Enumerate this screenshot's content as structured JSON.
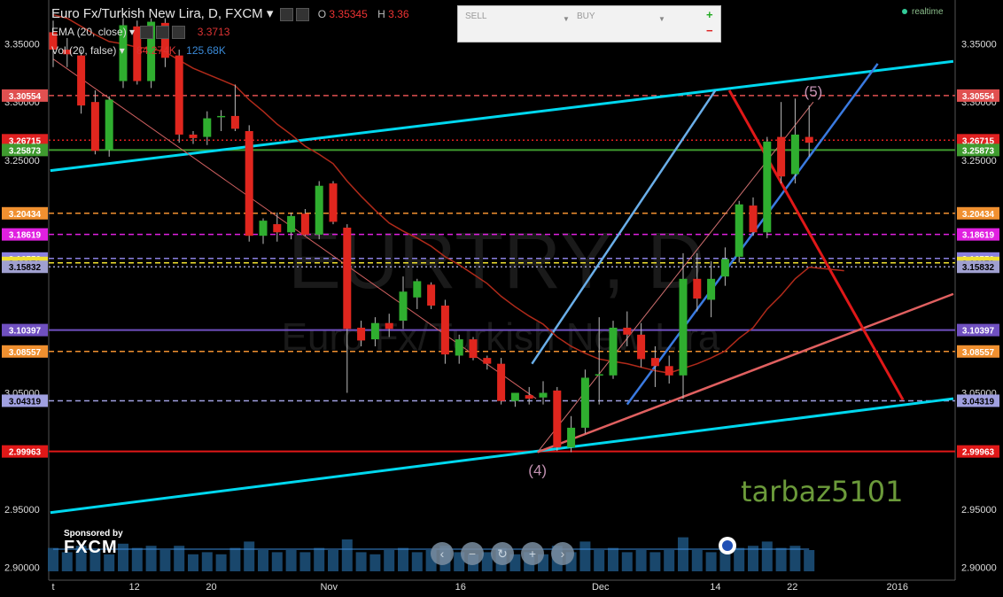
{
  "header": {
    "symbol": "Euro Fx/Turkish New Lira, D, FXCM ▾",
    "open_label": "O",
    "open_value": "3.35345",
    "high_label": "H",
    "high_value": "3.36"
  },
  "indicators": {
    "ema": "EMA (20, close) ▾",
    "ema_value": "3.3713",
    "vol": "Vol (20, false) ▾",
    "vol_value1": "84.274K",
    "vol_value2": "125.68K"
  },
  "trade_panel": {
    "sell_label": "SELL",
    "buy_label": "BUY",
    "plus": "+",
    "minus": "−"
  },
  "status": {
    "realtime": "realtime"
  },
  "sponsor": {
    "text": "Sponsored by",
    "brand": "FXCM"
  },
  "watermark": {
    "big": "EURTRY, D",
    "small": "Euro Fx/Turkish New Lira"
  },
  "author": "tarbaz5101",
  "wave_labels": [
    "(4)",
    "(5)"
  ],
  "nav_buttons": [
    "‹",
    "−",
    "↻",
    "+",
    "›"
  ],
  "colors": {
    "background": "#000000",
    "up": "#2fae2f",
    "down": "#e0261e",
    "ema": "#b02a1a",
    "channel": "#00d8ef"
  },
  "chart_data": {
    "type": "candlestick",
    "title": "Euro Fx/Turkish New Lira, D, FXCM",
    "ylim": [
      2.88,
      3.38
    ],
    "y_ticks": [
      "3.35000",
      "3.30000",
      "3.25000",
      "3.05000",
      "2.95000",
      "2.90000"
    ],
    "x_ticks": [
      "t",
      "12",
      "20",
      "Nov",
      "16",
      "Dec",
      "14",
      "22",
      "2016"
    ],
    "price_levels": [
      {
        "value": "3.30554",
        "color": "#e05050",
        "style": "dash"
      },
      {
        "value": "3.26715",
        "color": "#e02020",
        "style": "dot"
      },
      {
        "value": "3.25873",
        "color": "#3f9b2f",
        "style": "solid"
      },
      {
        "value": "3.20434",
        "color": "#f09030",
        "style": "dash"
      },
      {
        "value": "3.18619",
        "color": "#e020e0",
        "style": "dash"
      },
      {
        "value": "3.16550",
        "color": "#8a80e0",
        "style": "dash"
      },
      {
        "value": "3.16170",
        "color": "#f0e030",
        "style": "dash"
      },
      {
        "value": "3.15832",
        "color": "#a0a0d0",
        "style": "dot"
      },
      {
        "value": "3.10397",
        "color": "#7050c0",
        "style": "solid"
      },
      {
        "value": "3.08557",
        "color": "#f09030",
        "style": "dash"
      },
      {
        "value": "3.04319",
        "color": "#a0a0e0",
        "style": "dash"
      },
      {
        "value": "2.99963",
        "color": "#e01818",
        "style": "solid"
      }
    ],
    "candles": [
      {
        "o": 3.36,
        "h": 3.37,
        "l": 3.33,
        "c": 3.345
      },
      {
        "o": 3.345,
        "h": 3.355,
        "l": 3.33,
        "c": 3.341
      },
      {
        "o": 3.34,
        "h": 3.345,
        "l": 3.29,
        "c": 3.297
      },
      {
        "o": 3.3,
        "h": 3.31,
        "l": 3.255,
        "c": 3.258
      },
      {
        "o": 3.259,
        "h": 3.305,
        "l": 3.253,
        "c": 3.302
      },
      {
        "o": 3.318,
        "h": 3.372,
        "l": 3.312,
        "c": 3.366
      },
      {
        "o": 3.365,
        "h": 3.37,
        "l": 3.315,
        "c": 3.318
      },
      {
        "o": 3.318,
        "h": 3.372,
        "l": 3.312,
        "c": 3.369
      },
      {
        "o": 3.368,
        "h": 3.372,
        "l": 3.33,
        "c": 3.338
      },
      {
        "o": 3.34,
        "h": 3.345,
        "l": 3.265,
        "c": 3.272
      },
      {
        "o": 3.272,
        "h": 3.275,
        "l": 3.264,
        "c": 3.269
      },
      {
        "o": 3.27,
        "h": 3.292,
        "l": 3.263,
        "c": 3.286
      },
      {
        "o": 3.287,
        "h": 3.293,
        "l": 3.275,
        "c": 3.288
      },
      {
        "o": 3.288,
        "h": 3.315,
        "l": 3.275,
        "c": 3.277
      },
      {
        "o": 3.275,
        "h": 3.28,
        "l": 3.18,
        "c": 3.185
      },
      {
        "o": 3.185,
        "h": 3.2,
        "l": 3.178,
        "c": 3.198
      },
      {
        "o": 3.195,
        "h": 3.205,
        "l": 3.18,
        "c": 3.188
      },
      {
        "o": 3.188,
        "h": 3.205,
        "l": 3.182,
        "c": 3.202
      },
      {
        "o": 3.204,
        "h": 3.208,
        "l": 3.185,
        "c": 3.186
      },
      {
        "o": 3.186,
        "h": 3.232,
        "l": 3.182,
        "c": 3.228
      },
      {
        "o": 3.23,
        "h": 3.232,
        "l": 3.195,
        "c": 3.197
      },
      {
        "o": 3.192,
        "h": 3.195,
        "l": 3.05,
        "c": 3.105
      },
      {
        "o": 3.106,
        "h": 3.112,
        "l": 3.09,
        "c": 3.095
      },
      {
        "o": 3.096,
        "h": 3.115,
        "l": 3.09,
        "c": 3.11
      },
      {
        "o": 3.11,
        "h": 3.118,
        "l": 3.098,
        "c": 3.105
      },
      {
        "o": 3.112,
        "h": 3.15,
        "l": 3.105,
        "c": 3.137
      },
      {
        "o": 3.132,
        "h": 3.148,
        "l": 3.122,
        "c": 3.146
      },
      {
        "o": 3.143,
        "h": 3.145,
        "l": 3.122,
        "c": 3.125
      },
      {
        "o": 3.125,
        "h": 3.13,
        "l": 3.075,
        "c": 3.083
      },
      {
        "o": 3.082,
        "h": 3.1,
        "l": 3.075,
        "c": 3.096
      },
      {
        "o": 3.096,
        "h": 3.098,
        "l": 3.078,
        "c": 3.08
      },
      {
        "o": 3.08,
        "h": 3.082,
        "l": 3.07,
        "c": 3.075
      },
      {
        "o": 3.075,
        "h": 3.08,
        "l": 3.04,
        "c": 3.043
      },
      {
        "o": 3.043,
        "h": 3.05,
        "l": 3.038,
        "c": 3.05
      },
      {
        "o": 3.048,
        "h": 3.055,
        "l": 3.04,
        "c": 3.045
      },
      {
        "o": 3.046,
        "h": 3.06,
        "l": 3.04,
        "c": 3.05
      },
      {
        "o": 3.052,
        "h": 3.055,
        "l": 3.0,
        "c": 3.003
      },
      {
        "o": 3.003,
        "h": 3.03,
        "l": 2.999,
        "c": 3.02
      },
      {
        "o": 3.02,
        "h": 3.07,
        "l": 3.015,
        "c": 3.063
      },
      {
        "o": 3.065,
        "h": 3.115,
        "l": 3.04,
        "c": 3.066
      },
      {
        "o": 3.065,
        "h": 3.112,
        "l": 3.062,
        "c": 3.106
      },
      {
        "o": 3.106,
        "h": 3.12,
        "l": 3.09,
        "c": 3.1
      },
      {
        "o": 3.1,
        "h": 3.11,
        "l": 3.072,
        "c": 3.079
      },
      {
        "o": 3.08,
        "h": 3.09,
        "l": 3.055,
        "c": 3.073
      },
      {
        "o": 3.073,
        "h": 3.082,
        "l": 3.058,
        "c": 3.065
      },
      {
        "o": 3.065,
        "h": 3.17,
        "l": 3.045,
        "c": 3.148
      },
      {
        "o": 3.148,
        "h": 3.17,
        "l": 3.12,
        "c": 3.131
      },
      {
        "o": 3.13,
        "h": 3.163,
        "l": 3.115,
        "c": 3.148
      },
      {
        "o": 3.15,
        "h": 3.175,
        "l": 3.142,
        "c": 3.165
      },
      {
        "o": 3.167,
        "h": 3.215,
        "l": 3.162,
        "c": 3.212
      },
      {
        "o": 3.211,
        "h": 3.218,
        "l": 3.185,
        "c": 3.188
      },
      {
        "o": 3.188,
        "h": 3.27,
        "l": 3.183,
        "c": 3.266
      },
      {
        "o": 3.27,
        "h": 3.3,
        "l": 3.23,
        "c": 3.236
      },
      {
        "o": 3.238,
        "h": 3.303,
        "l": 3.23,
        "c": 3.272
      },
      {
        "o": 3.27,
        "h": 3.297,
        "l": 3.253,
        "c": 3.265
      }
    ],
    "ema_values": [
      3.375,
      3.372,
      3.365,
      3.358,
      3.352,
      3.35,
      3.347,
      3.346,
      3.343,
      3.336,
      3.329,
      3.324,
      3.319,
      3.314,
      3.302,
      3.292,
      3.281,
      3.272,
      3.262,
      3.255,
      3.247,
      3.232,
      3.219,
      3.207,
      3.196,
      3.189,
      3.183,
      3.176,
      3.167,
      3.16,
      3.152,
      3.144,
      3.133,
      3.124,
      3.116,
      3.109,
      3.098,
      3.09,
      3.084,
      3.079,
      3.077,
      3.075,
      3.072,
      3.069,
      3.067,
      3.071,
      3.075,
      3.08,
      3.086,
      3.097,
      3.106,
      3.122,
      3.134,
      3.148,
      3.158
    ],
    "volumes": [
      0.55,
      0.45,
      0.6,
      0.5,
      0.4,
      0.65,
      0.55,
      0.6,
      0.5,
      0.6,
      0.4,
      0.45,
      0.4,
      0.55,
      0.7,
      0.5,
      0.45,
      0.5,
      0.45,
      0.55,
      0.5,
      0.75,
      0.45,
      0.4,
      0.5,
      0.55,
      0.45,
      0.5,
      0.6,
      0.45,
      0.4,
      0.45,
      0.55,
      0.4,
      0.45,
      0.4,
      0.6,
      0.45,
      0.7,
      0.5,
      0.55,
      0.45,
      0.5,
      0.45,
      0.5,
      0.8,
      0.5,
      0.45,
      0.5,
      0.55,
      0.6,
      0.7,
      0.55,
      0.6,
      0.5
    ]
  }
}
